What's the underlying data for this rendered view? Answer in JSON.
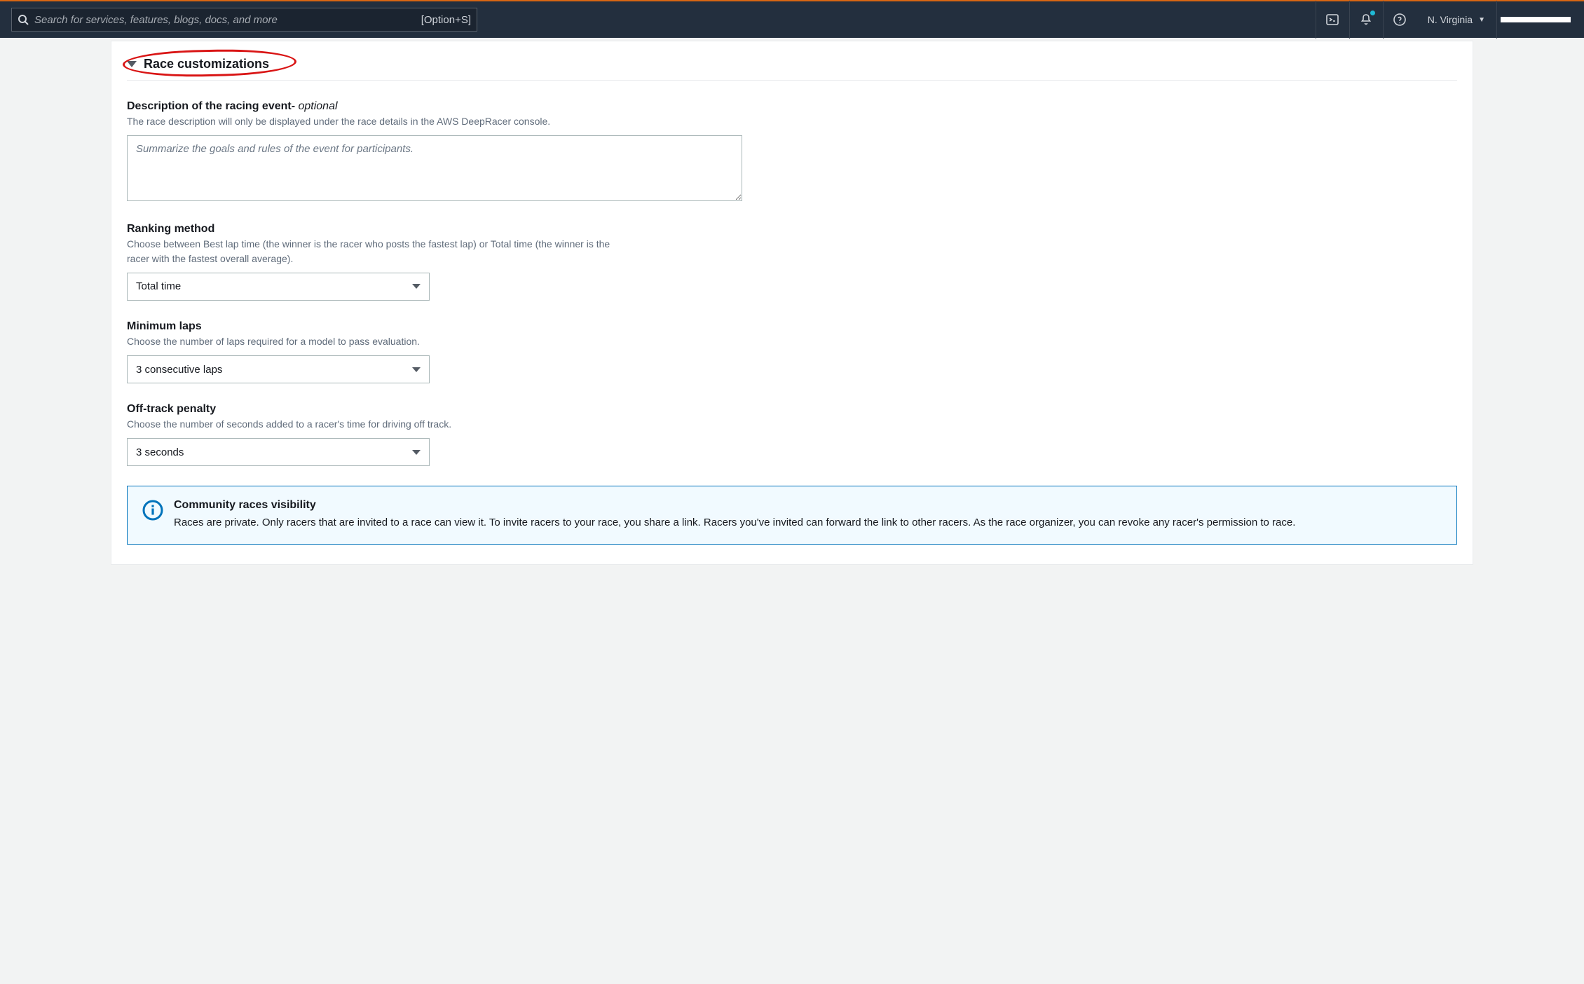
{
  "topbar": {
    "search_placeholder": "Search for services, features, blogs, docs, and more",
    "search_shortcut": "[Option+S]",
    "region_label": "N. Virginia"
  },
  "section": {
    "title": "Race customizations"
  },
  "description": {
    "label_main": "Description of the racing event- ",
    "label_optional": "optional",
    "help": "The race description will only be displayed under the race details in the AWS DeepRacer console.",
    "placeholder": "Summarize the goals and rules of the event for participants."
  },
  "ranking": {
    "label": "Ranking method",
    "help": "Choose between Best lap time (the winner is the racer who posts the fastest lap) or Total time (the winner is the racer with the fastest overall average).",
    "value": "Total time"
  },
  "minlaps": {
    "label": "Minimum laps",
    "help": "Choose the number of laps required for a model to pass evaluation.",
    "value": "3 consecutive laps"
  },
  "penalty": {
    "label": "Off-track penalty",
    "help": "Choose the number of seconds added to a racer's time for driving off track.",
    "value": "3 seconds"
  },
  "infobox": {
    "title": "Community races visibility",
    "body": "Races are private. Only racers that are invited to a race can view it. To invite racers to your race, you share a link. Racers you've invited can forward the link to other racers. As the race organizer, you can revoke any racer's permission to race."
  }
}
